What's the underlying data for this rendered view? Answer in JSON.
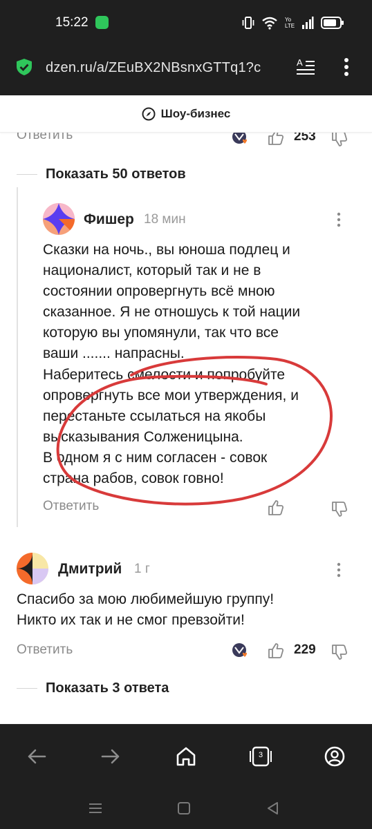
{
  "status_bar": {
    "time": "15:22",
    "network": "Yo LTE"
  },
  "browser": {
    "url": "dzen.ru/a/ZEuBX2NBsnxGTTq1?c",
    "tab_count": "3"
  },
  "category": {
    "label": "Шоу-бизнес"
  },
  "top_comment_footer": {
    "reply_label": "Ответить",
    "likes": "253"
  },
  "show_replies_1": "Показать 50 ответов",
  "reply_comment": {
    "author": "Фишер",
    "age": "18 мин",
    "lines": [
      "Сказки на ночь., вы юноша подлец и",
      "националист, который так и не в",
      "состоянии опровергнуть всё мною",
      "сказанное. Я не отношусь к той нации",
      "которую вы упомянули, так что все",
      "ваши ....... напрасны.",
      "Наберитесь смелости и попробуйте",
      "опровергнуть все мои утверждения, и",
      "перестаньте ссылаться на якобы",
      "высказывания Солженицына.",
      "В одном я с ним согласен - совок",
      "страна рабов, совок говно!"
    ],
    "reply_label": "Ответить"
  },
  "comment_2": {
    "author": "Дмитрий",
    "age": "1 г",
    "lines": [
      "Спасибо за мою любимейшую группу!",
      "Никто их так и не смог превзойти!"
    ],
    "reply_label": "Ответить",
    "likes": "229"
  },
  "show_replies_2": "Показать 3 ответа",
  "colors": {
    "dark_bar": "#1f1f1f",
    "shield_green": "#2fc65b",
    "annotation_red": "#d83a3a",
    "muted_text": "#8a8a8a"
  }
}
